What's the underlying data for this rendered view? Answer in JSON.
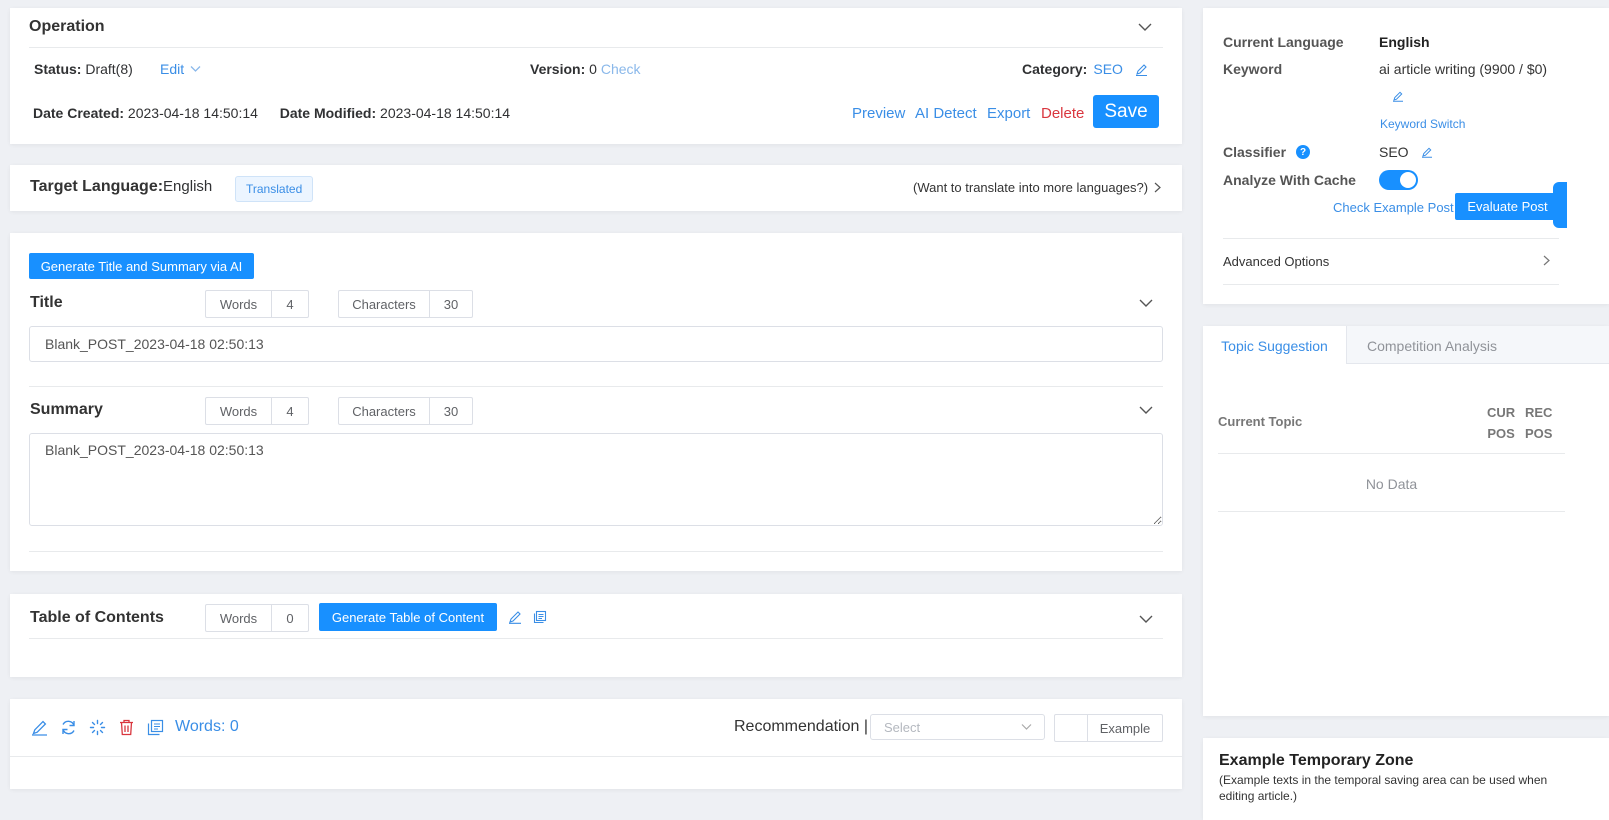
{
  "operation": {
    "title": "Operation",
    "status_label": "Status:",
    "status_value": "Draft(8)",
    "edit_label": "Edit",
    "version_label": "Version:",
    "version_value": "0",
    "version_check": "Check",
    "category_label": "Category:",
    "category_value": "SEO",
    "date_created_label": "Date Created:",
    "date_created_value": "2023-04-18 14:50:14",
    "date_modified_label": "Date Modified:",
    "date_modified_value": "2023-04-18 14:50:14",
    "actions": {
      "preview": "Preview",
      "ai_detect": "AI Detect",
      "export": "Export",
      "delete": "Delete",
      "save": "Save"
    }
  },
  "target_language": {
    "label": "Target Language:",
    "value": "English",
    "badge": "Translated",
    "more_link": "(Want to translate into more languages?)"
  },
  "title_section": {
    "generate_button": "Generate Title and Summary via AI",
    "title_label": "Title",
    "words_label": "Words",
    "words_value": "4",
    "chars_label": "Characters",
    "chars_value": "30",
    "title_value": "Blank_POST_2023-04-18 02:50:13",
    "summary_label": "Summary",
    "summary_words_value": "4",
    "summary_chars_value": "30",
    "summary_value": "Blank_POST_2023-04-18 02:50:13"
  },
  "toc": {
    "label": "Table of Contents",
    "words_label": "Words",
    "words_value": "0",
    "generate_button": "Generate Table of Content"
  },
  "editor_bar": {
    "words_text": "Words: 0",
    "recommendation_label": "Recommendation |",
    "select_placeholder": "Select",
    "example_button": "Example"
  },
  "right_panel": {
    "current_language_label": "Current Language",
    "current_language_value": "English",
    "keyword_label": "Keyword",
    "keyword_value": "ai article writing (9900 / $0)",
    "keyword_switch": "Keyword Switch",
    "classifier_label": "Classifier",
    "classifier_value": "SEO",
    "analyze_cache_label": "Analyze With Cache",
    "check_example": "Check Example Post",
    "evaluate_post": "Evaluate Post",
    "advanced_options": "Advanced Options"
  },
  "topic_panel": {
    "tabs": [
      "Topic Suggestion",
      "Competition Analysis"
    ],
    "col_current_topic": "Current Topic",
    "col_cur_pos_1": "CUR",
    "col_cur_pos_2": "POS",
    "col_rec_pos_1": "REC",
    "col_rec_pos_2": "POS",
    "empty": "No Data"
  },
  "example_zone": {
    "title": "Example Temporary Zone",
    "desc": "(Example texts in the temporal saving area can be used when editing article.)"
  },
  "colors": {
    "primary": "#1890ff",
    "danger": "#d9363e",
    "link": "#3a8ee6"
  }
}
